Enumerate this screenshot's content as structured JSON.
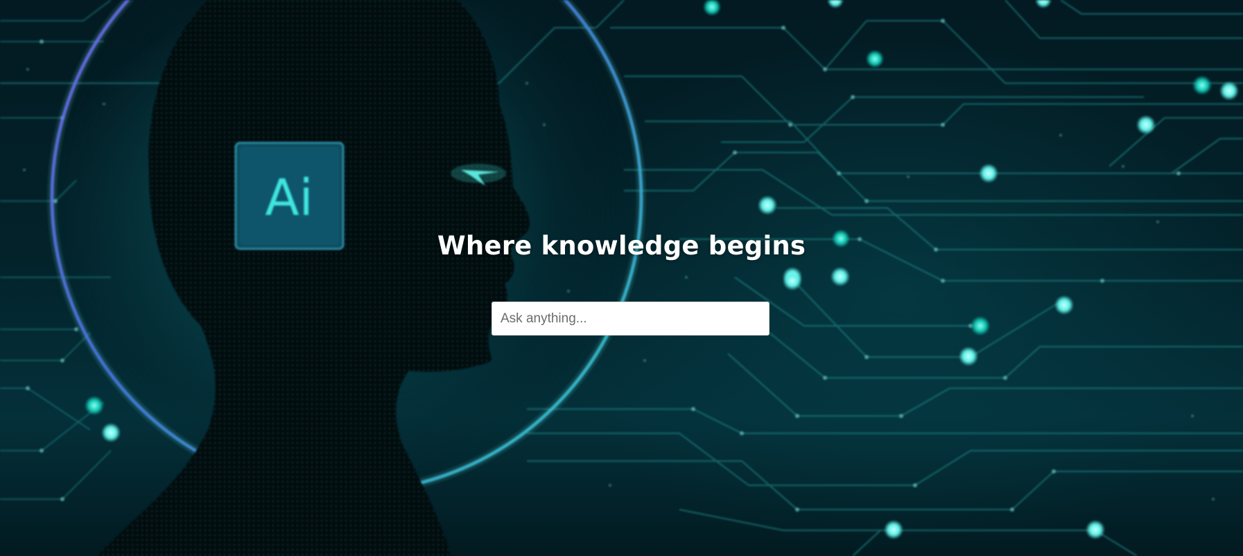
{
  "hero": {
    "title": "Where knowledge begins",
    "logo_text": "Ai"
  },
  "search": {
    "placeholder": "Ask anything...",
    "value": ""
  },
  "colors": {
    "accent_cyan": "#3fe6e0",
    "node_teal": "#12c9b5",
    "halo_purple": "#7b5cff",
    "text": "#ffffff"
  },
  "icons": {
    "logo": "ai-badge-icon"
  }
}
